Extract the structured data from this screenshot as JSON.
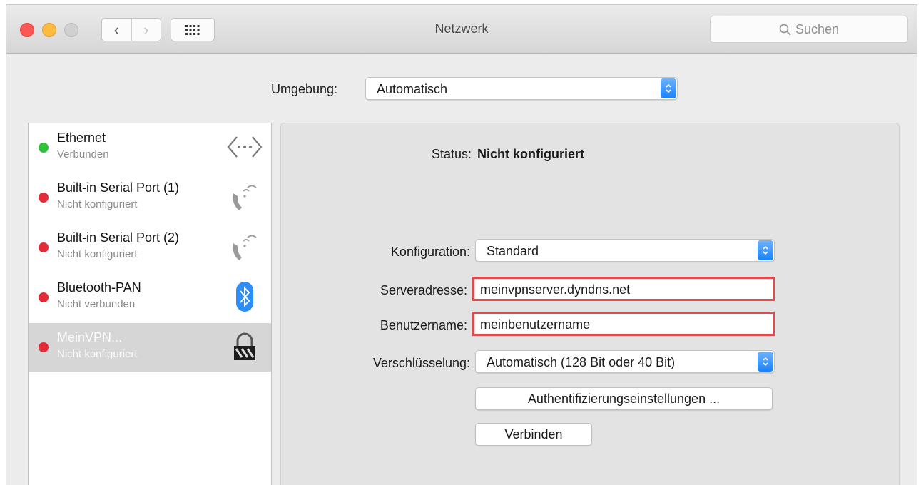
{
  "window": {
    "title": "Netzwerk",
    "search_placeholder": "Suchen",
    "nav": {
      "back": "‹",
      "forward": "›"
    }
  },
  "location": {
    "label": "Umgebung:",
    "value": "Automatisch"
  },
  "sidebar": {
    "items": [
      {
        "name": "Ethernet",
        "status": "Verbunden",
        "dot": "green",
        "icon": "ethernet-icon",
        "selected": false
      },
      {
        "name": "Built-in Serial Port (1)",
        "status": "Nicht konfiguriert",
        "dot": "red",
        "icon": "phone-icon",
        "selected": false
      },
      {
        "name": "Built-in Serial Port (2)",
        "status": "Nicht konfiguriert",
        "dot": "red",
        "icon": "phone-icon",
        "selected": false
      },
      {
        "name": "Bluetooth-PAN",
        "status": "Nicht verbunden",
        "dot": "red",
        "icon": "bluetooth-icon",
        "selected": false
      },
      {
        "name": "MeinVPN...",
        "status": "Nicht konfiguriert",
        "dot": "red",
        "icon": "vpn-lock-icon",
        "selected": true
      }
    ]
  },
  "detail": {
    "status_label": "Status:",
    "status_value": "Nicht konfiguriert",
    "config_label": "Konfiguration:",
    "config_value": "Standard",
    "server_label": "Serveradresse:",
    "server_value": "meinvpnserver.dyndns.net",
    "user_label": "Benutzername:",
    "user_value": "meinbenutzername",
    "encryption_label": "Verschlüsselung:",
    "encryption_value": "Automatisch (128 Bit oder 40 Bit)",
    "auth_button": "Authentifizierungseinstellungen ...",
    "connect_button": "Verbinden"
  },
  "colors": {
    "status_connected": "#2fc23a",
    "status_error": "#e32c3a",
    "highlight_border": "#e04a4a",
    "accent": "#1a82fb"
  }
}
